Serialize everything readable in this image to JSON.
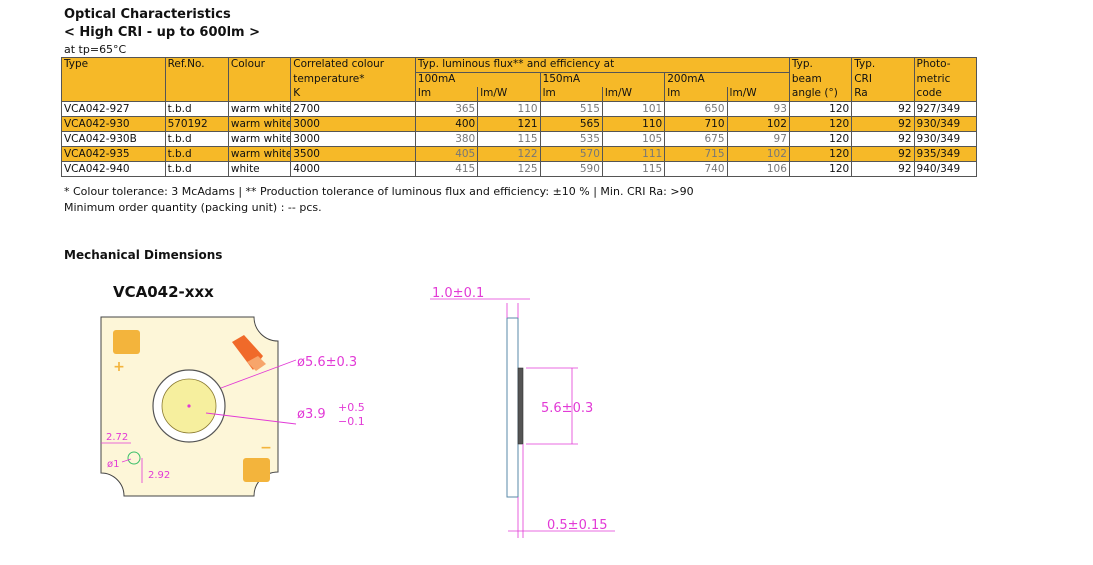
{
  "header": {
    "section_title": "Optical Characteristics",
    "subtitle": "< High CRI - up to 600lm >",
    "condition": "at tp=65°C"
  },
  "table": {
    "headers": {
      "type": "Type",
      "ref": "Ref.No.",
      "colour": "Colour",
      "cct_1": "Correlated colour",
      "cct_2": "temperature*",
      "cct_unit": "K",
      "flux_title": "Typ. luminous flux** and efficiency at",
      "current_1": "100mA",
      "current_2": "150mA",
      "current_3": "200mA",
      "lm": "lm",
      "lmw": "lm/W",
      "beam_1": "Typ.",
      "beam_2": "beam",
      "beam_3": "angle (°)",
      "cri_1": "Typ.",
      "cri_2": "CRI",
      "cri_3": "Ra",
      "photo_1": "Photo-",
      "photo_2": "metric",
      "photo_3": "code"
    },
    "rows": [
      {
        "type": "VCA042-927",
        "ref": "t.b.d",
        "colour": "warm white",
        "cct": "2700",
        "lm100": "365",
        "lmw100": "110",
        "lm150": "515",
        "lmw150": "101",
        "lm200": "650",
        "lmw200": "93",
        "beam": "120",
        "cri": "92",
        "photo": "927/349"
      },
      {
        "type": "VCA042-930",
        "ref": "570192",
        "colour": "warm white",
        "cct": "3000",
        "lm100": "400",
        "lmw100": "121",
        "lm150": "565",
        "lmw150": "110",
        "lm200": "710",
        "lmw200": "102",
        "beam": "120",
        "cri": "92",
        "photo": "930/349"
      },
      {
        "type": "VCA042-930B",
        "ref": "t.b.d",
        "colour": "warm white",
        "cct": "3000",
        "lm100": "380",
        "lmw100": "115",
        "lm150": "535",
        "lmw150": "105",
        "lm200": "675",
        "lmw200": "97",
        "beam": "120",
        "cri": "92",
        "photo": "930/349"
      },
      {
        "type": "VCA042-935",
        "ref": "t.b.d",
        "colour": "warm white",
        "cct": "3500",
        "lm100": "405",
        "lmw100": "122",
        "lm150": "570",
        "lmw150": "111",
        "lm200": "715",
        "lmw200": "102",
        "beam": "120",
        "cri": "92",
        "photo": "935/349"
      },
      {
        "type": "VCA042-940",
        "ref": "t.b.d",
        "colour": "white",
        "cct": "4000",
        "lm100": "415",
        "lmw100": "125",
        "lm150": "590",
        "lmw150": "115",
        "lm200": "740",
        "lmw200": "106",
        "beam": "120",
        "cri": "92",
        "photo": "940/349"
      }
    ]
  },
  "notes": {
    "line1": "* Colour tolerance: 3 McAdams | ** Production tolerance of luminous flux and efficiency: ±10 % | Min. CRI Ra: >90",
    "line2": "Minimum order quantity (packing unit) : -- pcs."
  },
  "mechanical": {
    "section_title": "Mechanical Dimensions",
    "model": "VCA042-xxx",
    "dim_outer_diameter": "ø5.6±0.3",
    "dim_inner_prefix": "ø3.9",
    "dim_inner_tol_plus": "+0.5",
    "dim_inner_tol_minus": "−0.1",
    "dim_left": "2.72",
    "dim_hole": "ø1",
    "dim_bottom": "2.92",
    "plus_sign": "+",
    "minus_sign": "−",
    "dim_thickness": "1.0±0.1",
    "dim_height": "5.6±0.3",
    "dim_lens": "0.5±0.15"
  },
  "colors": {
    "accent": "#f6b928",
    "dimension": "#e23ad6",
    "board": "#fdf6d8",
    "pad": "#f3b43c",
    "logo": "#f06a2a"
  }
}
